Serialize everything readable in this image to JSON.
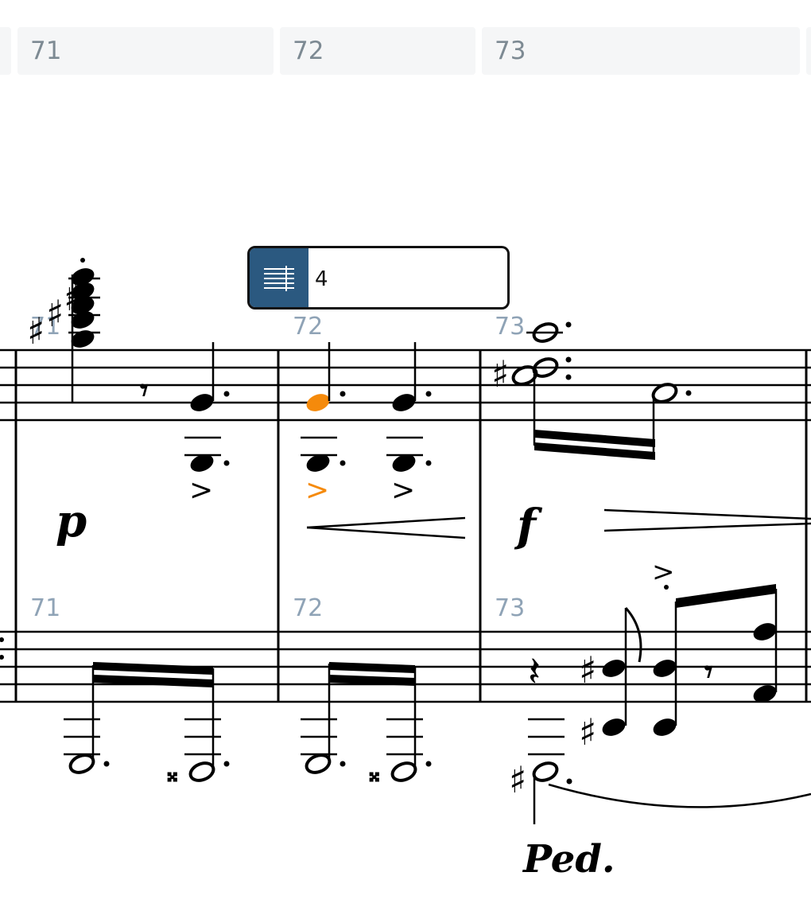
{
  "measure_ruler": [
    "71",
    "72",
    "73"
  ],
  "note_input_popup": {
    "icon": "staff-lines-icon",
    "value": "4"
  },
  "score": {
    "measure_numbers": [
      "71",
      "72",
      "73"
    ],
    "dynamics": {
      "m71": "p",
      "m73": "f"
    },
    "pedal_mark": "Ped.",
    "selected_color": "#f58a0b",
    "accent_glyph": ">"
  }
}
